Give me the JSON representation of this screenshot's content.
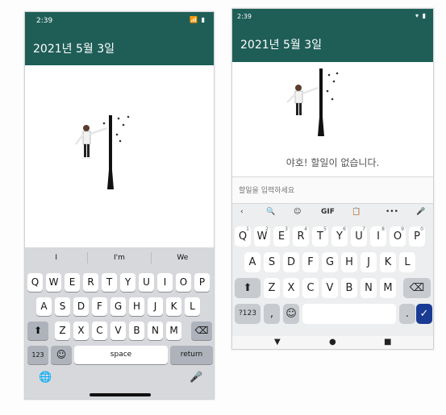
{
  "ios": {
    "status_time": "2:39",
    "status_icons": "📶 ▮",
    "app_title": "2021년 5월 3일",
    "suggestions": [
      "I",
      "I'm",
      "We"
    ],
    "rows": [
      [
        "Q",
        "W",
        "E",
        "R",
        "T",
        "Y",
        "U",
        "I",
        "O",
        "P"
      ],
      [
        "A",
        "S",
        "D",
        "F",
        "G",
        "H",
        "J",
        "K",
        "L"
      ],
      [
        "Z",
        "X",
        "C",
        "V",
        "B",
        "N",
        "M"
      ]
    ],
    "shift_icon": "⬆",
    "backspace_icon": "⌫",
    "numbers_label": "123",
    "emoji_icon": "☺",
    "space_label": "space",
    "return_label": "return",
    "globe_icon": "🌐",
    "mic_icon": "🎤"
  },
  "android": {
    "status_time": "2:39",
    "status_icons": "▾ ▮",
    "app_title": "2021년 5월 3일",
    "empty_message": "야호! 할일이 없습니다.",
    "input_placeholder": "할일을 입력하세요",
    "toolbar": [
      "‹",
      "🔍",
      "☺",
      "GIF",
      "📋",
      "•••",
      "🎤"
    ],
    "rows": [
      [
        "Q",
        "W",
        "E",
        "R",
        "T",
        "Y",
        "U",
        "I",
        "O",
        "P"
      ],
      [
        "A",
        "S",
        "D",
        "F",
        "G",
        "H",
        "J",
        "K",
        "L"
      ],
      [
        "Z",
        "X",
        "C",
        "V",
        "B",
        "N",
        "M"
      ]
    ],
    "top_row_digits": [
      "1",
      "2",
      "3",
      "4",
      "5",
      "6",
      "7",
      "8",
      "9",
      "0"
    ],
    "shift_icon": "⬆",
    "backspace_icon": "⌫",
    "symbols_label": "?123",
    "comma_label": ",",
    "emoji_icon": "☺",
    "period_label": ".",
    "enter_icon": "✓",
    "nav_back_icon": "▼",
    "nav_home_icon": "●",
    "nav_recents_icon": "■"
  },
  "colors": {
    "app_bar": "#1f5e57",
    "ios_keyboard_bg": "#d6d8dc",
    "android_keyboard_bg": "#eceeef",
    "android_enter": "#1a3b94"
  }
}
